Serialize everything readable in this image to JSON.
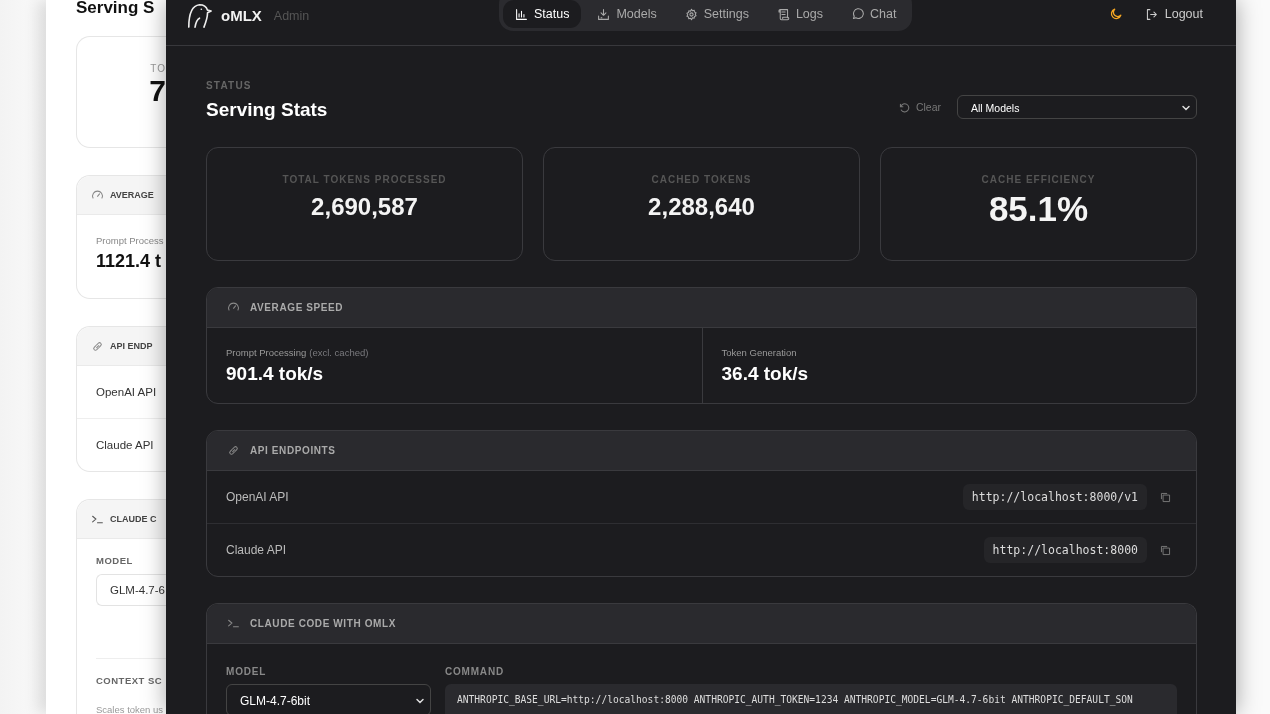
{
  "background_window": {
    "title": "Serving S",
    "stat_label": "TO",
    "stat_value": "7",
    "speed": {
      "title": "AVERAGE",
      "label": "Prompt Process",
      "value": "1121.4 t"
    },
    "endpoints": {
      "title": "API ENDP",
      "rows": [
        "OpenAI API",
        "Claude API"
      ]
    },
    "claude": {
      "title": "CLAUDE C",
      "model_label": "MODEL",
      "model_value": "GLM-4.7-6",
      "context_label": "CONTEXT SC",
      "context_hint": "Scales token us"
    }
  },
  "app": {
    "brand": "oMLX",
    "subtitle": "Admin",
    "logout": "Logout",
    "nav": [
      {
        "label": "Status",
        "kind": "chart",
        "selected": true
      },
      {
        "label": "Models",
        "kind": "download",
        "selected": false
      },
      {
        "label": "Settings",
        "kind": "gear",
        "selected": false
      },
      {
        "label": "Logs",
        "kind": "scroll",
        "selected": false
      },
      {
        "label": "Chat",
        "kind": "chat",
        "selected": false
      }
    ]
  },
  "page": {
    "eyebrow": "STATUS",
    "title": "Serving Stats",
    "clear": "Clear",
    "model_filter": "All Models"
  },
  "stats": [
    {
      "label": "TOTAL TOKENS PROCESSED",
      "value": "2,690,587",
      "kind": "count"
    },
    {
      "label": "CACHED TOKENS",
      "value": "2,288,640",
      "kind": "count"
    },
    {
      "label": "CACHE EFFICIENCY",
      "value": "85.1%",
      "kind": "percent"
    }
  ],
  "speed": {
    "title": "AVERAGE SPEED",
    "items": [
      {
        "label": "Prompt Processing",
        "note": "(excl. cached)",
        "value": "901.4 tok/s"
      },
      {
        "label": "Token Generation",
        "value": "36.4 tok/s"
      }
    ]
  },
  "endpoints": {
    "title": "API ENDPOINTS",
    "rows": [
      {
        "name": "OpenAI API",
        "url": "http://localhost:8000/v1"
      },
      {
        "name": "Claude API",
        "url": "http://localhost:8000"
      }
    ]
  },
  "claude_code": {
    "title": "CLAUDE CODE WITH OMLX",
    "model_label": "MODEL",
    "model": "GLM-4.7-6bit",
    "command_label": "COMMAND",
    "command": "ANTHROPIC_BASE_URL=http://localhost:8000 ANTHROPIC_AUTH_TOKEN=1234 ANTHROPIC_MODEL=GLM-4.7-6bit ANTHROPIC_DEFAULT_SON"
  }
}
